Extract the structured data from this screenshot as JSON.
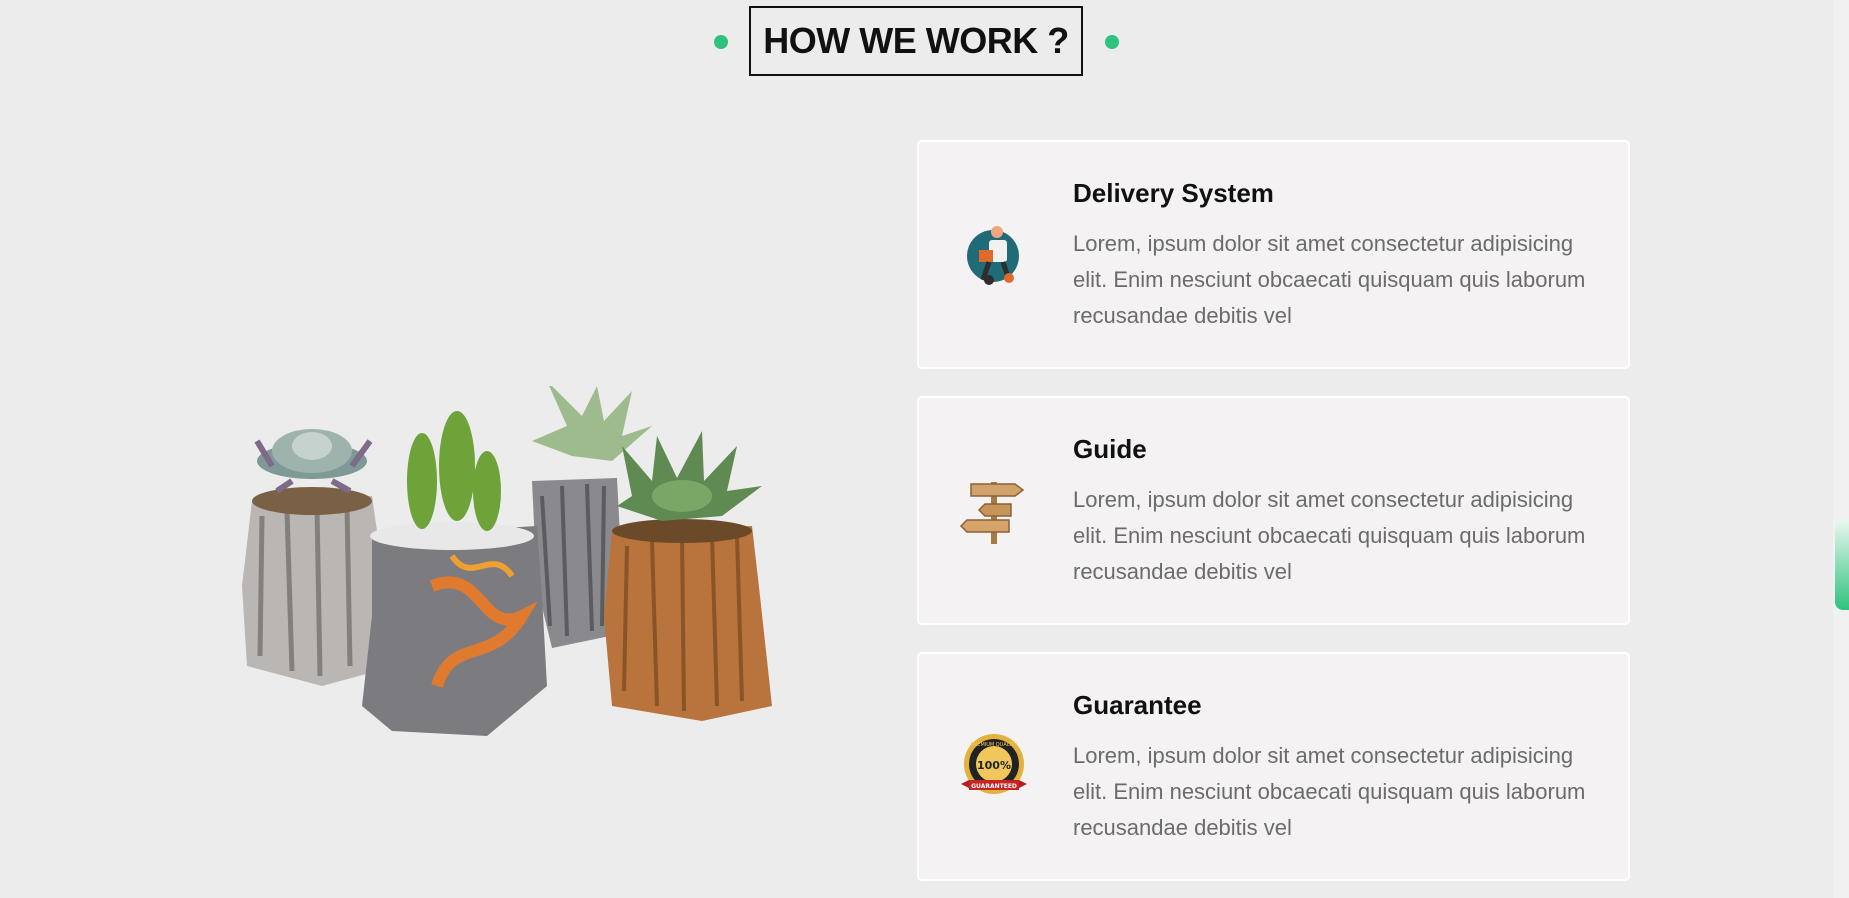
{
  "section": {
    "title": "HOW WE WORK ?"
  },
  "cards": [
    {
      "title": "Delivery System",
      "text": "Lorem, ipsum dolor sit amet consectetur adipisicing elit. Enim nesciunt obcaecati quisquam quis laborum recusandae debitis vel",
      "icon": "delivery-courier-icon"
    },
    {
      "title": "Guide",
      "text": "Lorem, ipsum dolor sit amet consectetur adipisicing elit. Enim nesciunt obcaecati quisquam quis laborum recusandae debitis vel",
      "icon": "signpost-icon"
    },
    {
      "title": "Guarantee",
      "text": "Lorem, ipsum dolor sit amet consectetur adipisicing elit. Enim nesciunt obcaecati quisquam quis laborum recusandae debitis vel",
      "icon": "guarantee-badge-icon",
      "badge": {
        "top_text": "PREMIUM QUALITY",
        "center_text": "100%",
        "ribbon_text": "GUARANTEED"
      }
    }
  ],
  "colors": {
    "accent": "#2ec27e",
    "background": "#ececec",
    "card": "#f4f2f2",
    "body_text": "#6b6b6b"
  }
}
